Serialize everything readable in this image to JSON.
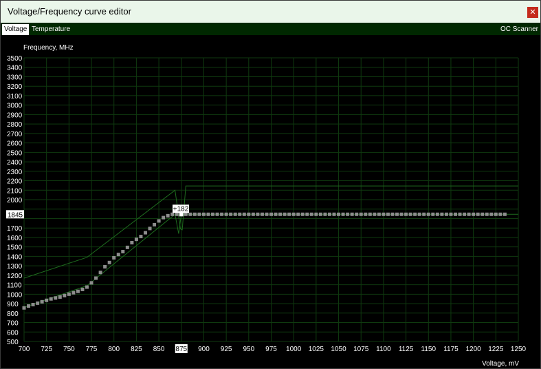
{
  "window": {
    "title": "Voltage/Frequency curve editor",
    "close_glyph": "✕"
  },
  "tabs": [
    {
      "label": "Voltage",
      "active": true
    },
    {
      "label": "Temperature",
      "active": false
    }
  ],
  "toolbar": {
    "oc_scanner": "OC Scanner"
  },
  "colors": {
    "grid": "#0f3a0f",
    "line": "#1e6b1e",
    "points": "#8c8c8c",
    "text": "#ffffff"
  },
  "chart_data": {
    "type": "line",
    "ylabel": "Frequency, MHz",
    "xlabel": "Voltage, mV",
    "xlim": [
      700,
      1250
    ],
    "ylim": [
      500,
      3500
    ],
    "x_ticks": [
      700,
      725,
      750,
      775,
      800,
      825,
      850,
      875,
      900,
      925,
      950,
      975,
      1000,
      1025,
      1050,
      1075,
      1100,
      1125,
      1150,
      1175,
      1200,
      1225,
      1250
    ],
    "y_ticks": [
      500,
      600,
      700,
      800,
      900,
      1000,
      1100,
      1200,
      1300,
      1400,
      1500,
      1600,
      1700,
      1800,
      1900,
      2000,
      2100,
      2200,
      2300,
      2400,
      2500,
      2600,
      2700,
      2800,
      2900,
      3000,
      3100,
      3200,
      3300,
      3400,
      3500
    ],
    "selected": {
      "x": 875,
      "y": 1845,
      "offset_label": "+182",
      "x_label": "875",
      "y_label": "1845"
    },
    "series": [
      {
        "role": "curve-points",
        "points": [
          [
            700,
            855
          ],
          [
            705,
            875
          ],
          [
            710,
            890
          ],
          [
            715,
            905
          ],
          [
            720,
            920
          ],
          [
            725,
            935
          ],
          [
            730,
            950
          ],
          [
            735,
            960
          ],
          [
            740,
            970
          ],
          [
            745,
            985
          ],
          [
            750,
            1000
          ],
          [
            755,
            1015
          ],
          [
            760,
            1030
          ],
          [
            765,
            1050
          ],
          [
            770,
            1075
          ],
          [
            775,
            1120
          ],
          [
            780,
            1170
          ],
          [
            785,
            1230
          ],
          [
            790,
            1290
          ],
          [
            795,
            1335
          ],
          [
            800,
            1385
          ],
          [
            805,
            1420
          ],
          [
            810,
            1450
          ],
          [
            815,
            1495
          ],
          [
            820,
            1545
          ],
          [
            825,
            1580
          ],
          [
            830,
            1610
          ],
          [
            835,
            1650
          ],
          [
            840,
            1695
          ],
          [
            845,
            1735
          ],
          [
            850,
            1775
          ],
          [
            855,
            1810
          ],
          [
            860,
            1830
          ],
          [
            865,
            1845
          ],
          [
            870,
            1845
          ],
          [
            875,
            1845
          ],
          [
            880,
            1845
          ],
          [
            885,
            1845
          ],
          [
            890,
            1845
          ],
          [
            895,
            1845
          ],
          [
            900,
            1845
          ],
          [
            905,
            1845
          ],
          [
            910,
            1845
          ],
          [
            915,
            1845
          ],
          [
            920,
            1845
          ],
          [
            925,
            1845
          ],
          [
            930,
            1845
          ],
          [
            935,
            1845
          ],
          [
            940,
            1845
          ],
          [
            945,
            1845
          ],
          [
            950,
            1845
          ],
          [
            955,
            1845
          ],
          [
            960,
            1845
          ],
          [
            965,
            1845
          ],
          [
            970,
            1845
          ],
          [
            975,
            1845
          ],
          [
            980,
            1845
          ],
          [
            985,
            1845
          ],
          [
            990,
            1845
          ],
          [
            995,
            1845
          ],
          [
            1000,
            1845
          ],
          [
            1005,
            1845
          ],
          [
            1010,
            1845
          ],
          [
            1015,
            1845
          ],
          [
            1020,
            1845
          ],
          [
            1025,
            1845
          ],
          [
            1030,
            1845
          ],
          [
            1035,
            1845
          ],
          [
            1040,
            1845
          ],
          [
            1045,
            1845
          ],
          [
            1050,
            1845
          ],
          [
            1055,
            1845
          ],
          [
            1060,
            1845
          ],
          [
            1065,
            1845
          ],
          [
            1070,
            1845
          ],
          [
            1075,
            1845
          ],
          [
            1080,
            1845
          ],
          [
            1085,
            1845
          ],
          [
            1090,
            1845
          ],
          [
            1095,
            1845
          ],
          [
            1100,
            1845
          ],
          [
            1105,
            1845
          ],
          [
            1110,
            1845
          ],
          [
            1115,
            1845
          ],
          [
            1120,
            1845
          ],
          [
            1125,
            1845
          ],
          [
            1130,
            1845
          ],
          [
            1135,
            1845
          ],
          [
            1140,
            1845
          ],
          [
            1145,
            1845
          ],
          [
            1150,
            1845
          ],
          [
            1155,
            1845
          ],
          [
            1160,
            1845
          ],
          [
            1165,
            1845
          ],
          [
            1170,
            1845
          ],
          [
            1175,
            1845
          ],
          [
            1180,
            1845
          ],
          [
            1185,
            1845
          ],
          [
            1190,
            1845
          ],
          [
            1195,
            1845
          ],
          [
            1200,
            1845
          ],
          [
            1205,
            1845
          ],
          [
            1210,
            1845
          ],
          [
            1215,
            1845
          ],
          [
            1220,
            1845
          ],
          [
            1225,
            1845
          ],
          [
            1230,
            1845
          ],
          [
            1235,
            1845
          ]
        ]
      },
      {
        "role": "upper-line",
        "points": [
          [
            700,
            1170
          ],
          [
            770,
            1390
          ],
          [
            868,
            2100
          ],
          [
            874,
            1690
          ],
          [
            876,
            1680
          ],
          [
            880,
            2145
          ],
          [
            1250,
            2145
          ]
        ]
      },
      {
        "role": "lower-line",
        "points": [
          [
            700,
            860
          ],
          [
            770,
            1090
          ],
          [
            868,
            1845
          ],
          [
            872,
            1640
          ],
          [
            875,
            1845
          ],
          [
            1250,
            1845
          ]
        ]
      }
    ]
  }
}
